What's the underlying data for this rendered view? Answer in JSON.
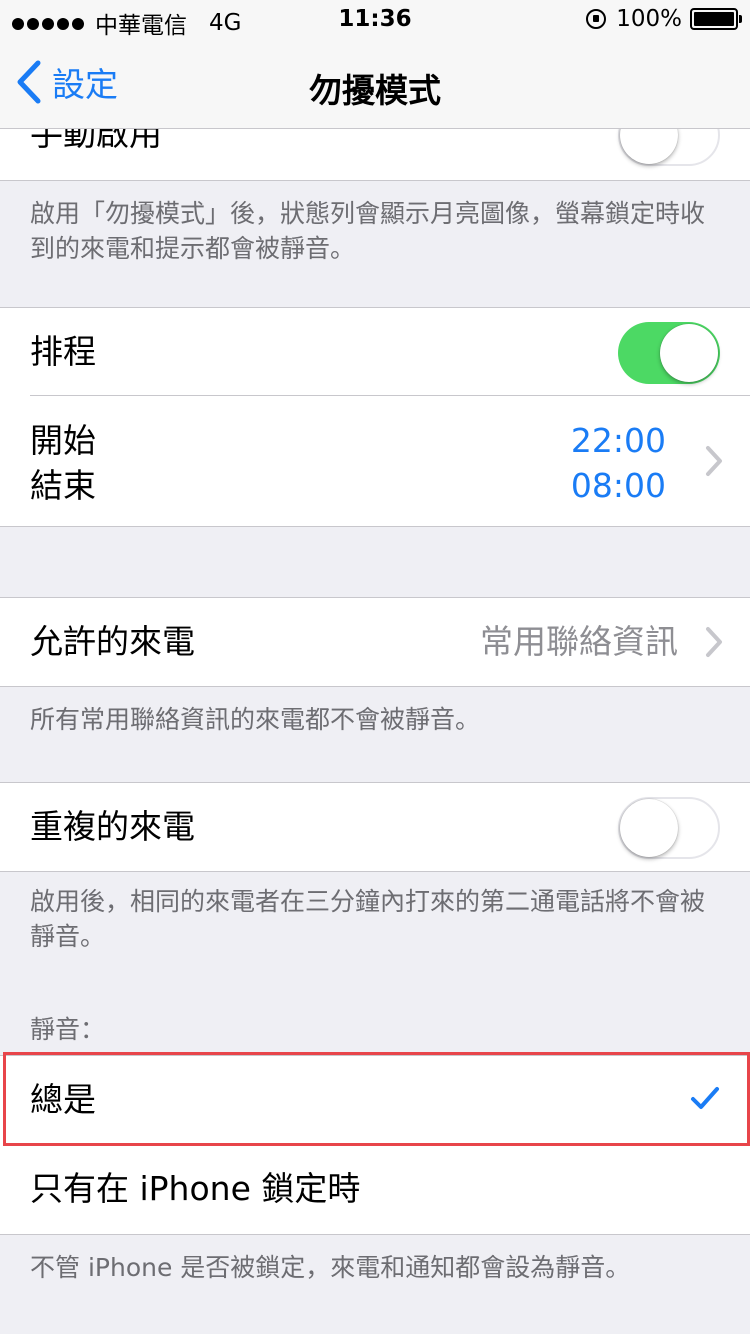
{
  "status_bar": {
    "carrier": "中華電信",
    "network": "4G",
    "time": "11:36",
    "battery": "100%"
  },
  "nav": {
    "back_label": "設定",
    "title": "勿擾模式"
  },
  "manual": {
    "label": "手動啟用",
    "enabled": false,
    "footer": "啟用「勿擾模式」後，狀態列會顯示月亮圖像，螢幕鎖定時收到的來電和提示都會被靜音。"
  },
  "schedule": {
    "label": "排程",
    "enabled": true,
    "start_label": "開始",
    "end_label": "結束",
    "start_time": "22:00",
    "end_time": "08:00"
  },
  "allow_calls": {
    "label": "允許的來電",
    "value": "常用聯絡資訊",
    "footer": "所有常用聯絡資訊的來電都不會被靜音。"
  },
  "repeated_calls": {
    "label": "重複的來電",
    "enabled": false,
    "footer": "啟用後，相同的來電者在三分鐘內打來的第二通電話將不會被靜音。"
  },
  "silence": {
    "header": "靜音：",
    "options": [
      {
        "label": "總是",
        "selected": true
      },
      {
        "label": "只有在 iPhone 鎖定時",
        "selected": false
      }
    ],
    "footer": "不管 iPhone 是否被鎖定，來電和通知都會設為靜音。"
  },
  "colors": {
    "accent": "#1a7cf5",
    "toggle_on": "#4cd964",
    "highlight": "#e8454a"
  }
}
